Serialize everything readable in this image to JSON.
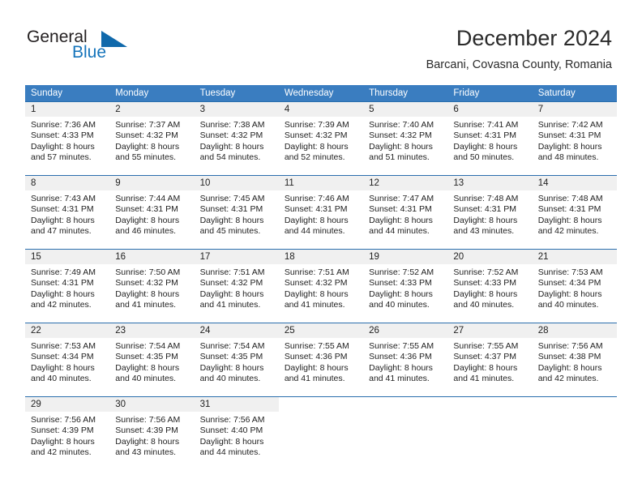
{
  "brand": {
    "name_part1": "General",
    "name_part2": "Blue",
    "triangle_icon": "triangle-icon",
    "color_dark": "#231f20",
    "color_blue": "#1574bb"
  },
  "header": {
    "title": "December 2024",
    "subtitle": "Barcani, Covasna County, Romania"
  },
  "theme": {
    "header_blue": "#3a7dc0",
    "divider_blue": "#2a6ead",
    "day_strip_gray": "#f0f0f0",
    "text": "#222222"
  },
  "weekdays": [
    "Sunday",
    "Monday",
    "Tuesday",
    "Wednesday",
    "Thursday",
    "Friday",
    "Saturday"
  ],
  "weeks": [
    {
      "days": [
        {
          "num": "1",
          "l1": "Sunrise: 7:36 AM",
          "l2": "Sunset: 4:33 PM",
          "l3": "Daylight: 8 hours",
          "l4": "and 57 minutes."
        },
        {
          "num": "2",
          "l1": "Sunrise: 7:37 AM",
          "l2": "Sunset: 4:32 PM",
          "l3": "Daylight: 8 hours",
          "l4": "and 55 minutes."
        },
        {
          "num": "3",
          "l1": "Sunrise: 7:38 AM",
          "l2": "Sunset: 4:32 PM",
          "l3": "Daylight: 8 hours",
          "l4": "and 54 minutes."
        },
        {
          "num": "4",
          "l1": "Sunrise: 7:39 AM",
          "l2": "Sunset: 4:32 PM",
          "l3": "Daylight: 8 hours",
          "l4": "and 52 minutes."
        },
        {
          "num": "5",
          "l1": "Sunrise: 7:40 AM",
          "l2": "Sunset: 4:32 PM",
          "l3": "Daylight: 8 hours",
          "l4": "and 51 minutes."
        },
        {
          "num": "6",
          "l1": "Sunrise: 7:41 AM",
          "l2": "Sunset: 4:31 PM",
          "l3": "Daylight: 8 hours",
          "l4": "and 50 minutes."
        },
        {
          "num": "7",
          "l1": "Sunrise: 7:42 AM",
          "l2": "Sunset: 4:31 PM",
          "l3": "Daylight: 8 hours",
          "l4": "and 48 minutes."
        }
      ]
    },
    {
      "days": [
        {
          "num": "8",
          "l1": "Sunrise: 7:43 AM",
          "l2": "Sunset: 4:31 PM",
          "l3": "Daylight: 8 hours",
          "l4": "and 47 minutes."
        },
        {
          "num": "9",
          "l1": "Sunrise: 7:44 AM",
          "l2": "Sunset: 4:31 PM",
          "l3": "Daylight: 8 hours",
          "l4": "and 46 minutes."
        },
        {
          "num": "10",
          "l1": "Sunrise: 7:45 AM",
          "l2": "Sunset: 4:31 PM",
          "l3": "Daylight: 8 hours",
          "l4": "and 45 minutes."
        },
        {
          "num": "11",
          "l1": "Sunrise: 7:46 AM",
          "l2": "Sunset: 4:31 PM",
          "l3": "Daylight: 8 hours",
          "l4": "and 44 minutes."
        },
        {
          "num": "12",
          "l1": "Sunrise: 7:47 AM",
          "l2": "Sunset: 4:31 PM",
          "l3": "Daylight: 8 hours",
          "l4": "and 44 minutes."
        },
        {
          "num": "13",
          "l1": "Sunrise: 7:48 AM",
          "l2": "Sunset: 4:31 PM",
          "l3": "Daylight: 8 hours",
          "l4": "and 43 minutes."
        },
        {
          "num": "14",
          "l1": "Sunrise: 7:48 AM",
          "l2": "Sunset: 4:31 PM",
          "l3": "Daylight: 8 hours",
          "l4": "and 42 minutes."
        }
      ]
    },
    {
      "days": [
        {
          "num": "15",
          "l1": "Sunrise: 7:49 AM",
          "l2": "Sunset: 4:31 PM",
          "l3": "Daylight: 8 hours",
          "l4": "and 42 minutes."
        },
        {
          "num": "16",
          "l1": "Sunrise: 7:50 AM",
          "l2": "Sunset: 4:32 PM",
          "l3": "Daylight: 8 hours",
          "l4": "and 41 minutes."
        },
        {
          "num": "17",
          "l1": "Sunrise: 7:51 AM",
          "l2": "Sunset: 4:32 PM",
          "l3": "Daylight: 8 hours",
          "l4": "and 41 minutes."
        },
        {
          "num": "18",
          "l1": "Sunrise: 7:51 AM",
          "l2": "Sunset: 4:32 PM",
          "l3": "Daylight: 8 hours",
          "l4": "and 41 minutes."
        },
        {
          "num": "19",
          "l1": "Sunrise: 7:52 AM",
          "l2": "Sunset: 4:33 PM",
          "l3": "Daylight: 8 hours",
          "l4": "and 40 minutes."
        },
        {
          "num": "20",
          "l1": "Sunrise: 7:52 AM",
          "l2": "Sunset: 4:33 PM",
          "l3": "Daylight: 8 hours",
          "l4": "and 40 minutes."
        },
        {
          "num": "21",
          "l1": "Sunrise: 7:53 AM",
          "l2": "Sunset: 4:34 PM",
          "l3": "Daylight: 8 hours",
          "l4": "and 40 minutes."
        }
      ]
    },
    {
      "days": [
        {
          "num": "22",
          "l1": "Sunrise: 7:53 AM",
          "l2": "Sunset: 4:34 PM",
          "l3": "Daylight: 8 hours",
          "l4": "and 40 minutes."
        },
        {
          "num": "23",
          "l1": "Sunrise: 7:54 AM",
          "l2": "Sunset: 4:35 PM",
          "l3": "Daylight: 8 hours",
          "l4": "and 40 minutes."
        },
        {
          "num": "24",
          "l1": "Sunrise: 7:54 AM",
          "l2": "Sunset: 4:35 PM",
          "l3": "Daylight: 8 hours",
          "l4": "and 40 minutes."
        },
        {
          "num": "25",
          "l1": "Sunrise: 7:55 AM",
          "l2": "Sunset: 4:36 PM",
          "l3": "Daylight: 8 hours",
          "l4": "and 41 minutes."
        },
        {
          "num": "26",
          "l1": "Sunrise: 7:55 AM",
          "l2": "Sunset: 4:36 PM",
          "l3": "Daylight: 8 hours",
          "l4": "and 41 minutes."
        },
        {
          "num": "27",
          "l1": "Sunrise: 7:55 AM",
          "l2": "Sunset: 4:37 PM",
          "l3": "Daylight: 8 hours",
          "l4": "and 41 minutes."
        },
        {
          "num": "28",
          "l1": "Sunrise: 7:56 AM",
          "l2": "Sunset: 4:38 PM",
          "l3": "Daylight: 8 hours",
          "l4": "and 42 minutes."
        }
      ]
    },
    {
      "days": [
        {
          "num": "29",
          "l1": "Sunrise: 7:56 AM",
          "l2": "Sunset: 4:39 PM",
          "l3": "Daylight: 8 hours",
          "l4": "and 42 minutes."
        },
        {
          "num": "30",
          "l1": "Sunrise: 7:56 AM",
          "l2": "Sunset: 4:39 PM",
          "l3": "Daylight: 8 hours",
          "l4": "and 43 minutes."
        },
        {
          "num": "31",
          "l1": "Sunrise: 7:56 AM",
          "l2": "Sunset: 4:40 PM",
          "l3": "Daylight: 8 hours",
          "l4": "and 44 minutes."
        },
        {
          "num": "",
          "l1": "",
          "l2": "",
          "l3": "",
          "l4": ""
        },
        {
          "num": "",
          "l1": "",
          "l2": "",
          "l3": "",
          "l4": ""
        },
        {
          "num": "",
          "l1": "",
          "l2": "",
          "l3": "",
          "l4": ""
        },
        {
          "num": "",
          "l1": "",
          "l2": "",
          "l3": "",
          "l4": ""
        }
      ]
    }
  ]
}
